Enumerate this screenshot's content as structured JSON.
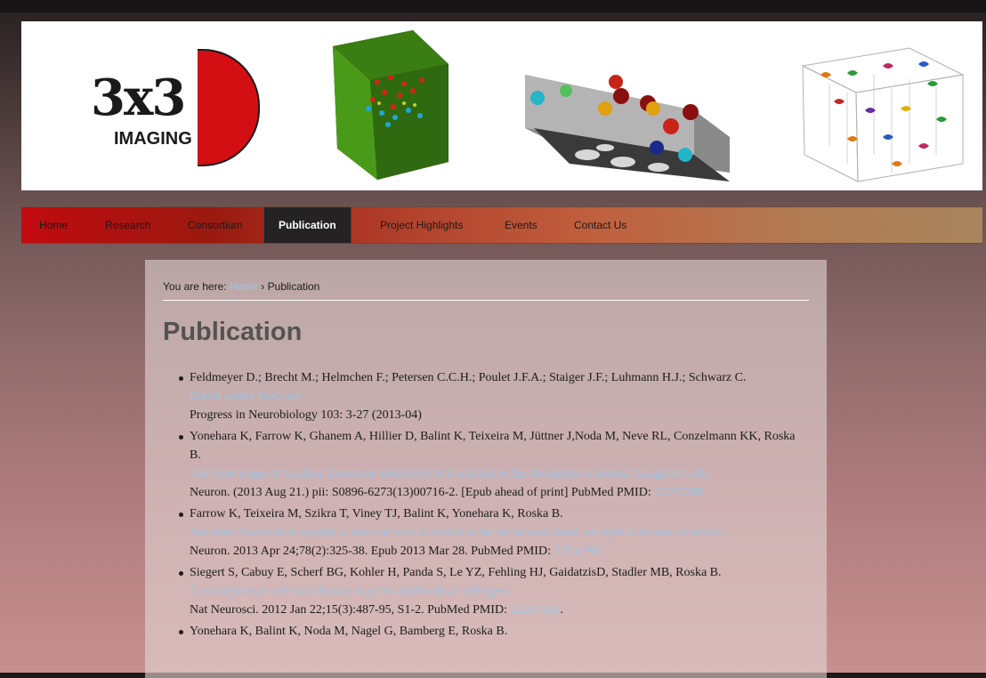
{
  "header": {
    "logo": {
      "main": "3x3",
      "sub": "IMAGING"
    }
  },
  "nav": {
    "items": [
      {
        "label": "Home"
      },
      {
        "label": "Research"
      },
      {
        "label": "Consortium"
      },
      {
        "label": "Publication"
      },
      {
        "label": "Project Highlights"
      },
      {
        "label": "Events"
      },
      {
        "label": "Contact Us"
      }
    ],
    "active": "Publication"
  },
  "breadcrumb": {
    "prefix": "You are here: ",
    "home": "Home",
    "separator": " › ",
    "current": "Publication"
  },
  "page": {
    "title": "Publication"
  },
  "publications": [
    {
      "authors": "Feldmeyer D.; Brecht M.; Helmchen F.; Petersen C.C.H.; Poulet J.F.A.; Staiger J.F.; Luhmann H.J.; Schwarz C.",
      "title": "Barrel cortex function",
      "citation": "Progress in Neurobiology 103: 3-27 (2013-04)",
      "pmid": ""
    },
    {
      "authors": "Yonehara K, Farrow K, Ghanem A, Hillier D, Balint K, Teixeira M, Jüttner J,Noda M, Neve RL, Conzelmann KK, Roska B.",
      "title": "The First Stage of Cardinal Direction Selectivity Is Localized to the Dendrites of Retinal Ganglion Cells.",
      "citation": "Neuron. (2013 Aug 21.) pii: S0896-6273(13)00716-2. [Epub ahead of print] PubMed PMID: ",
      "pmid": "23973208"
    },
    {
      "authors": "Farrow K, Teixeira M, Szikra T, Viney TJ, Balint K, Yonehara K, Roska B.",
      "title": "Ambient illumination toggles a neuronal circuit switch in the retina and visual perception at cone threshold.",
      "citation": "Neuron. 2013 Apr 24;78(2):325-38. Epub 2013 Mar 28. PubMed PMID: ",
      "pmid": "23541902"
    },
    {
      "authors": "Siegert S, Cabuy E, Scherf BG, Kohler H, Panda S, Le YZ, Fehling HJ, GaidatzisD, Stadler MB, Roska B.",
      "title": "Transcriptional code and disease map for adult retinal cell types.",
      "citation": "Nat Neurosci. 2012 Jan 22;15(3):487-95, S1-2. PubMed PMID: ",
      "pmid": "22267162",
      "suffix": "."
    },
    {
      "authors": "Yonehara K, Balint K, Noda M, Nagel G, Bamberg E, Roska B.",
      "title": "",
      "citation": "",
      "pmid": ""
    }
  ],
  "colors": {
    "nav_active_bg": "#242222",
    "link": "#9ec4e4",
    "logo_red": "#d40f14"
  }
}
